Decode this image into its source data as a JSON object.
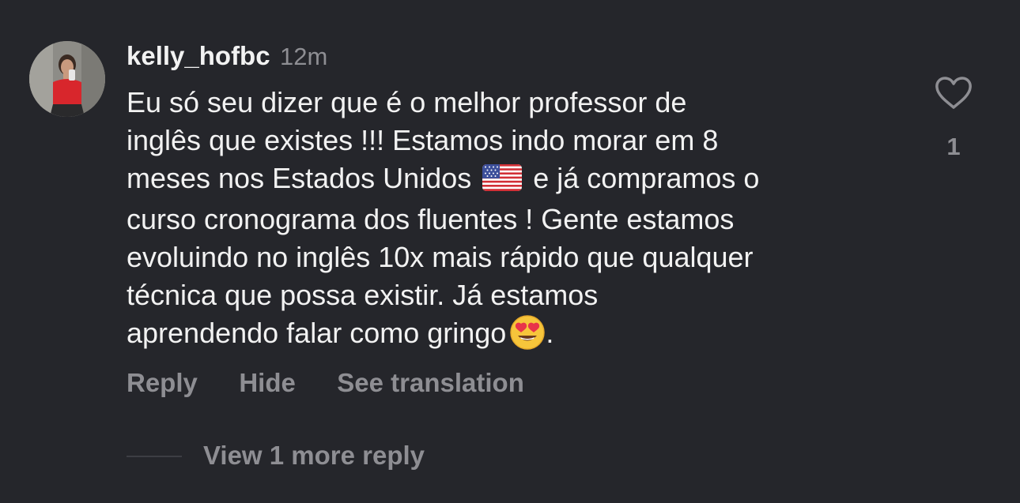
{
  "comment": {
    "username": "kelly_hofbc",
    "time": "12m",
    "text": {
      "line1": "Eu só seu dizer que é o melhor professor de",
      "line2": "inglês que existes !!! Estamos indo morar em 8",
      "line3_before": "meses nos Estados Unidos",
      "line3_after": "e já compramos o",
      "line4": "curso cronograma  dos fluentes ! Gente estamos",
      "line5": "evoluindo no inglês 10x mais rápido que qualquer",
      "line6": "técnica que possa existir. Já estamos",
      "line7_before": "aprendendo falar como gringo",
      "line7_after": "."
    },
    "like_count": "1",
    "actions": {
      "reply": "Reply",
      "hide": "Hide",
      "see_translation": "See translation"
    },
    "view_replies": "View 1 more reply"
  },
  "icons": {
    "like": "heart-outline-icon",
    "flag": "us-flag-emoji",
    "emoji": "heart-eyes-emoji"
  },
  "colors": {
    "background": "#25262b",
    "text_primary": "#f2f2f2",
    "text_secondary": "#8e8e93"
  }
}
